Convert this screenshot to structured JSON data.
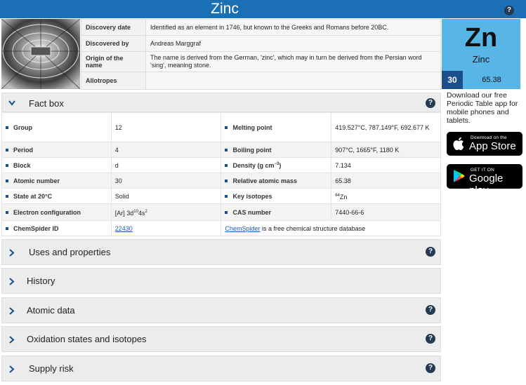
{
  "header": {
    "title": "Zinc"
  },
  "info": [
    {
      "label": "Discovery date",
      "value": "Identified as an element in 1746, but known to the Greeks and Romans before 20BC."
    },
    {
      "label": "Discovered by",
      "value": "Andreas Marggraf"
    },
    {
      "label": "Origin of the name",
      "value": "The name is derived from the German, 'zinc', which may in turn be derived from the Persian word 'sing', meaning stone."
    },
    {
      "label": "Allotropes",
      "value": ""
    }
  ],
  "tile": {
    "symbol": "Zn",
    "name": "Zinc",
    "number": "30",
    "mass": "65.38"
  },
  "sidebar": {
    "download_text": "Download our free Periodic Table app for mobile phones and tablets.",
    "app_store": {
      "small": "Download on the",
      "big": "App Store"
    },
    "google_play": {
      "small": "GET IT ON",
      "big": "Google play"
    }
  },
  "fact_box": {
    "title": "Fact box",
    "rows": [
      {
        "k1": "Group",
        "v1": "12",
        "k2": "Melting point",
        "v2": "419.527°C, 787.149°F, 692.677 K"
      },
      {
        "k1": "Period",
        "v1": "4",
        "k2": "Boiling point",
        "v2": "907°C, 1665°F, 1180 K"
      },
      {
        "k1": "Block",
        "v1": "d",
        "k2": "Density (g cm",
        "k2_sup": "−3",
        "k2_tail": ")",
        "v2": "7.134"
      },
      {
        "k1": "Atomic number",
        "v1": "30",
        "k2": "Relative atomic mass",
        "v2": "65.38"
      },
      {
        "k1": "State at 20°C",
        "v1": "Solid",
        "k2": "Key isotopes",
        "v2_sup": "64",
        "v2": "Zn"
      },
      {
        "k1": "Electron configuration",
        "v1_a": "[Ar] 3d",
        "v1_sup1": "10",
        "v1_b": "4s",
        "v1_sup2": "2",
        "k2": "CAS number",
        "v2": "7440-66-6"
      }
    ],
    "chemspider": {
      "label": "ChemSpider ID",
      "id": "22430",
      "link": "ChemSpider",
      "text": " is a free chemical structure database"
    }
  },
  "sections": [
    {
      "title": "Uses and properties",
      "help": true
    },
    {
      "title": "History",
      "help": false
    },
    {
      "title": "Atomic data",
      "help": true
    },
    {
      "title": "Oxidation states and isotopes",
      "help": true
    },
    {
      "title": "Supply risk",
      "help": true
    }
  ],
  "icons": {
    "help": "help-icon",
    "expand": "chevron-right-icon",
    "collapse": "chevron-down-icon"
  },
  "colors": {
    "title_bar": "#1a6fb5",
    "tile": "#58b6e6",
    "tile_number": "#1a4f8a"
  }
}
